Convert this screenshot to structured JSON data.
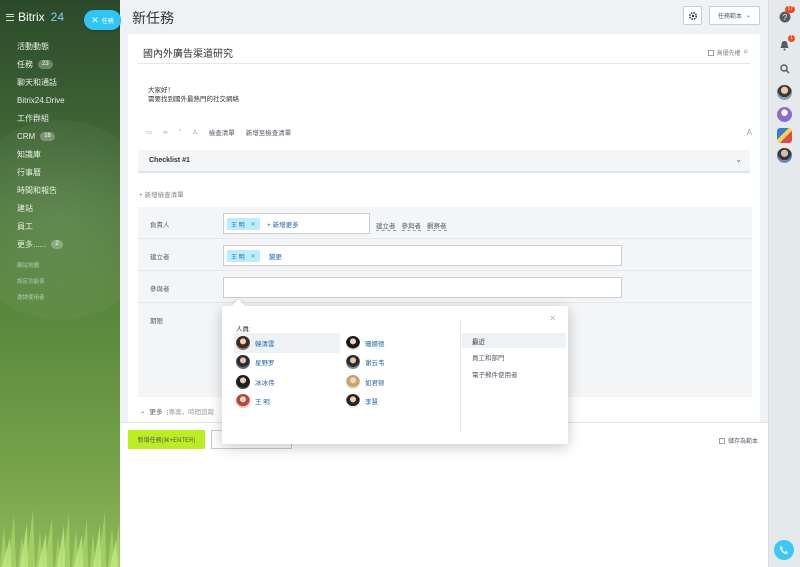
{
  "brand": {
    "name": "Bitrix",
    "suffix": "24"
  },
  "sidebar": {
    "items": [
      {
        "label": "活動動態",
        "badge": ""
      },
      {
        "label": "任務",
        "badge": "23"
      },
      {
        "label": "聊天和通話",
        "badge": ""
      },
      {
        "label": "Bitrix24.Drive",
        "badge": ""
      },
      {
        "label": "工作群組",
        "badge": ""
      },
      {
        "label": "CRM",
        "badge": "16"
      },
      {
        "label": "知識庫",
        "badge": ""
      },
      {
        "label": "行事曆",
        "badge": ""
      },
      {
        "label": "時間和報告",
        "badge": ""
      },
      {
        "label": "建站",
        "badge": ""
      },
      {
        "label": "員工",
        "badge": ""
      },
      {
        "label": "更多......",
        "badge": "2"
      }
    ],
    "footer_links": [
      "網站地圖",
      "設定功能表",
      "邀請使用者"
    ]
  },
  "header": {
    "fab_label": "任務",
    "title": "新任務",
    "template_button": "任務範本"
  },
  "right_rail": {
    "help_count": "17",
    "notifications_count": "1",
    "icons": [
      "help-icon",
      "bell-icon",
      "search-icon",
      "phone-icon"
    ]
  },
  "form": {
    "task_title": "國內外廣告渠道研究",
    "priority_label": "高優先權",
    "description_line1": "大家好！",
    "description_line2": "需要找到國外最熱門的社交網絡",
    "toolbar": {
      "checklist_link": "檢查清單",
      "add_to_checklist_link": "新增至檢查清單",
      "format_icon_text": "A"
    },
    "checklist_title": "Checklist #1",
    "add_checklist": "+ 新增檢查清單",
    "responsible": {
      "label": "負責人",
      "chip": "王 明",
      "add_more": "+ 新增更多",
      "links": [
        "建立者",
        "參與者",
        "觀察者"
      ]
    },
    "creator": {
      "label": "建立者",
      "chip": "王 明",
      "change": "變更"
    },
    "participants": {
      "label": "參與者"
    },
    "deadline": {
      "label": "期限"
    },
    "more": {
      "label": "更多",
      "hint": "(專案，時間追蹤"
    },
    "submit_label": "新增任務(⌘+ENTER)",
    "save_as_template": "儲存為範本"
  },
  "popup": {
    "label": "人員:",
    "left_column": [
      {
        "name": "韓清雲",
        "selected": true
      },
      {
        "name": "星野罗",
        "selected": false
      },
      {
        "name": "冰冰伟",
        "selected": false
      },
      {
        "name": "王 明",
        "selected": false
      }
    ],
    "right_column": [
      {
        "name": "珊娜德"
      },
      {
        "name": "谢云韦"
      },
      {
        "name": "如君顿"
      },
      {
        "name": "李慧"
      }
    ],
    "tabs": [
      {
        "label": "最近",
        "selected": true
      },
      {
        "label": "員工和部門",
        "selected": false
      },
      {
        "label": "電子郵件使用者",
        "selected": false
      }
    ]
  },
  "colors": {
    "accent_blue": "#2fc6f6",
    "submit_green": "#bbed21",
    "link_blue": "#2067b0",
    "chip_bg": "#bcedfc",
    "badge_red": "#f54819"
  }
}
